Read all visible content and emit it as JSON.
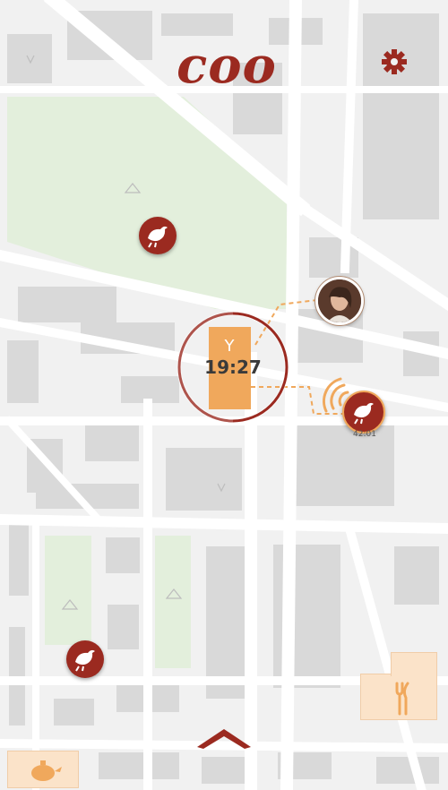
{
  "app": {
    "logo_text": "coo",
    "logo_color": "#9b2a20",
    "accent_color": "#9b2a20",
    "highlight_color": "#f0a85c"
  },
  "map": {
    "park_color": "#e3efdc",
    "block_color": "#d9d9d9",
    "road_color": "#ffffff"
  },
  "venue": {
    "time": "19:27",
    "icon": "fork-knife-icon"
  },
  "nearby_user": {
    "status_text": "42:01",
    "icon": "bird-icon"
  },
  "icons": {
    "settings": "gear-icon",
    "bird": "bird-icon",
    "signal": "signal-waves-icon",
    "food": "fork-knife-icon",
    "cafe": "teapot-icon",
    "expand": "chevron-up-icon"
  }
}
